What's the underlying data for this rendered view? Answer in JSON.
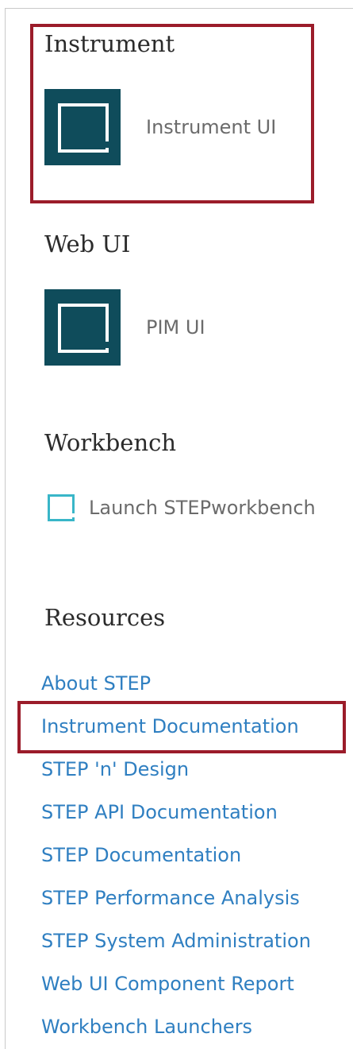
{
  "sections": {
    "instrument": {
      "title": "Instrument",
      "tile_label": "Instrument UI"
    },
    "web_ui": {
      "title": "Web UI",
      "tile_label": "PIM UI"
    },
    "workbench": {
      "title": "Workbench",
      "link_label": "Launch STEPworkbench"
    },
    "resources": {
      "title": "Resources",
      "links": [
        "About STEP",
        "Instrument Documentation",
        "STEP 'n' Design",
        "STEP API Documentation",
        "STEP Documentation",
        "STEP Performance Analysis",
        "STEP System Administration",
        "Web UI Component Report",
        "Workbench Launchers"
      ]
    }
  },
  "colors": {
    "tile": "#0f4c5b",
    "workbench_icon": "#39b6c8",
    "link": "#2f7fc1",
    "highlight": "#9b1c2a"
  }
}
